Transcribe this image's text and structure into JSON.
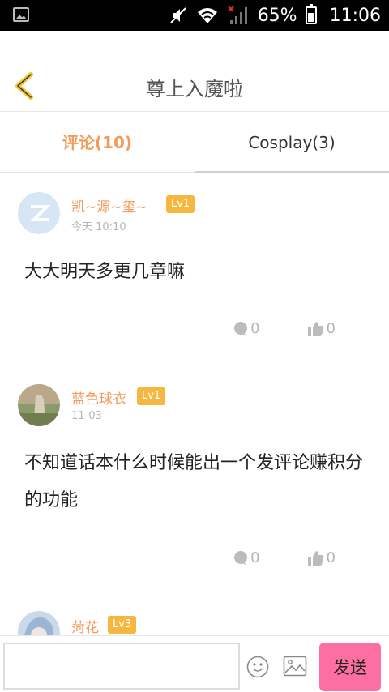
{
  "status_bar": {
    "battery": "65%",
    "time": "11:06"
  },
  "header": {
    "title": "尊上入魔啦"
  },
  "tabs": [
    {
      "label": "评论(10)"
    },
    {
      "label": "Cosplay(3)"
    }
  ],
  "comments": [
    {
      "username": "凯~源~玺~",
      "level": "Lv1",
      "time": "今天 10:10",
      "content": "大大明天多更几章嘛",
      "replies": "0",
      "likes": "0"
    },
    {
      "username": "蓝色球衣",
      "level": "Lv1",
      "time": "11-03",
      "content": "不知道话本什么时候能出一个发评论赚积分的功能",
      "replies": "0",
      "likes": "0"
    },
    {
      "username": "菏花",
      "level": "Lv3",
      "time": "",
      "content": ""
    }
  ],
  "input_bar": {
    "placeholder": "",
    "send_label": "发送"
  },
  "colors": {
    "accent": "#f39b5a",
    "level_badge": "#f5b740",
    "send_button": "#fd6fa0"
  }
}
